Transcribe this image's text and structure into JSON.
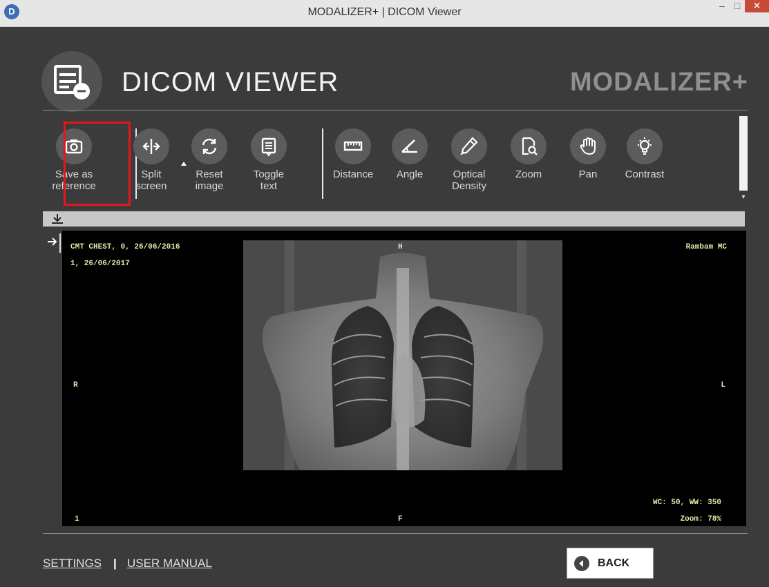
{
  "window": {
    "app_icon_letter": "D",
    "title": "MODALIZER+ | DICOM Viewer",
    "min_label": "–",
    "max_label": "□",
    "close_label": "✕"
  },
  "header": {
    "title": "DICOM VIEWER",
    "brand": "MODALIZER+",
    "logo_icon": "document-list-icon"
  },
  "toolbar": {
    "tools": [
      {
        "id": "save-as-reference",
        "label_line1": "Save as",
        "label_line2": "reference",
        "icon": "camera-icon",
        "highlighted": true
      },
      {
        "id": "split-screen",
        "label_line1": "Split",
        "label_line2": "screen",
        "icon": "split-arrows-icon"
      },
      {
        "id": "reset-image",
        "label_line1": "Reset",
        "label_line2": "image",
        "icon": "refresh-icon"
      },
      {
        "id": "toggle-text",
        "label_line1": "Toggle",
        "label_line2": "text",
        "icon": "text-doc-icon"
      },
      {
        "id": "distance",
        "label_line1": "Distance",
        "label_line2": "",
        "icon": "ruler-icon"
      },
      {
        "id": "angle",
        "label_line1": "Angle",
        "label_line2": "",
        "icon": "angle-icon"
      },
      {
        "id": "optical-density",
        "label_line1": "Optical",
        "label_line2": "Density",
        "icon": "pen-icon"
      },
      {
        "id": "zoom",
        "label_line1": "Zoom",
        "label_line2": "",
        "icon": "zoom-doc-icon"
      },
      {
        "id": "pan",
        "label_line1": "Pan",
        "label_line2": "",
        "icon": "hand-icon"
      },
      {
        "id": "contrast",
        "label_line1": "Contrast",
        "label_line2": "",
        "icon": "lightbulb-icon"
      }
    ],
    "highlight_color": "#e8151b"
  },
  "viewer": {
    "overlay": {
      "top_left_line1": "CMT CHEST, 0, 26/06/2016",
      "top_left_line2": "1, 26/06/2017",
      "top_center": "H",
      "top_right": "Rambam MC",
      "left_center": "R",
      "right_center": "L",
      "bottom_left": "1",
      "bottom_center": "F",
      "bottom_right_line1": "WC: 50, WW: 350",
      "bottom_right_line2": "Zoom: 78%"
    },
    "overlay_color": "#e6e6a8"
  },
  "footer": {
    "settings_label": "SETTINGS",
    "separator": "|",
    "manual_label": "USER MANUAL",
    "back_label": "BACK"
  }
}
